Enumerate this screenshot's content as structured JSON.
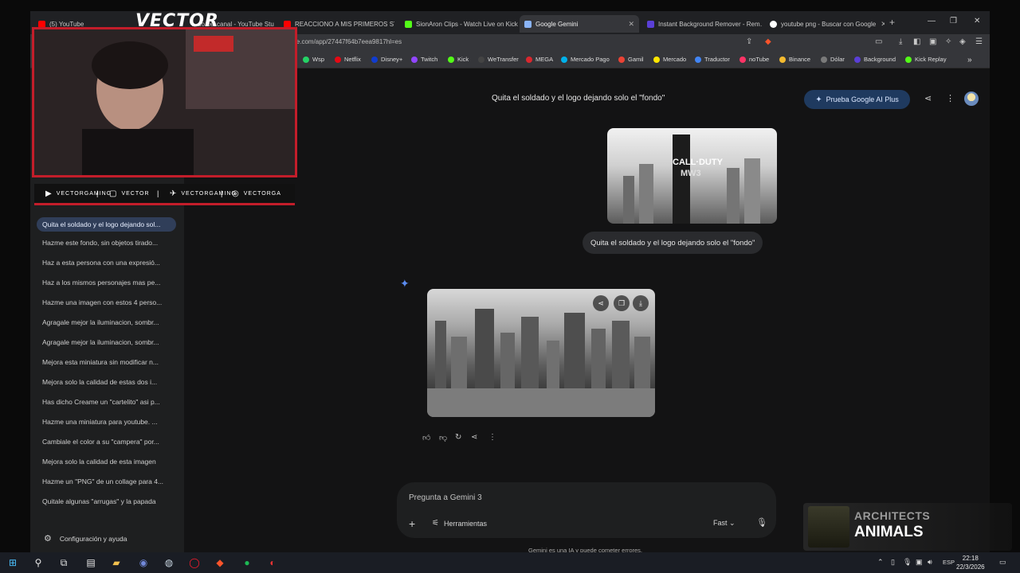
{
  "browser": {
    "tabs": [
      {
        "label": "(5) YouTube",
        "color": "#ff0000"
      },
      {
        "label": "…do del canal - YouTube Studio",
        "color": "#ff0000"
      },
      {
        "label": "REACCIONO A MIS PRIMEROS STRE…",
        "color": "#ff0000"
      },
      {
        "label": "SionAron Clips - Watch Live on Kick",
        "color": "#53fc18"
      },
      {
        "label": "Google Gemini",
        "color": "#8ab4f8"
      },
      {
        "label": "Instant Background Remover - Rem…",
        "color": "#5a3fd6"
      },
      {
        "label": "youtube png - Buscar con Google",
        "color": "#ffffff"
      }
    ],
    "url": "le.com/app/27447f64b7eea9817hl=es",
    "bookmarks": [
      "Wsp",
      "Netflix",
      "Disney+",
      "Twitch",
      "Kick",
      "WeTransfer",
      "MEGA",
      "Mercado Pago",
      "Gamil",
      "Mercado",
      "Traductor",
      "noTube",
      "Binance",
      "Dólar",
      "Background",
      "Kick Replay"
    ]
  },
  "gemini": {
    "chat_title": "Quita el soldado y el logo dejando solo el \"fondo\"",
    "upgrade_label": "Prueba Google AI Plus",
    "sidebar_items": [
      "Quita el soldado y el logo dejando sol...",
      "Hazme este fondo, sin objetos tirado...",
      "Haz a esta persona con una expresió...",
      "Haz a los mismos personajes mas pe...",
      "Hazme una imagen con estos 4 perso...",
      "Agragale mejor la iluminacion, sombr...",
      "Agragale mejor la iluminacion, sombr...",
      "Mejora esta miniatura sin modificar n...",
      "Mejora solo la calidad de estas dos i...",
      "Has dicho Creame un \"cartelito\" asi p...",
      "Hazme una miniatura para youtube. ...",
      "Cambiale el color a su \"campera\" por...",
      "Mejora solo la calidad de esta imagen",
      "Hazme un \"PNG\" de un collage para 4...",
      "Quitale algunas \"arrugas\" y la papada"
    ],
    "settings_label": "Configuración y ayuda",
    "user_image_text": [
      "CALL·DUTY",
      "MW3"
    ],
    "user_message": "Quita el soldado y el logo dejando solo el \"fondo\"",
    "input_placeholder": "Pregunta a Gemini 3",
    "tools_label": "Herramientas",
    "mode_label": "Fast",
    "disclaimer": "Gemini es una IA y puede cometer errores."
  },
  "overlay": {
    "logo": "VECTOR",
    "socials": [
      {
        "icon": "youtube-icon",
        "label": "VECTORGAMING"
      },
      {
        "icon": "chat-icon",
        "label": "VECTOR"
      },
      {
        "icon": "twitter-icon",
        "label": "VECTORGAMING"
      },
      {
        "icon": "instagram-icon",
        "label": "VECTORGA"
      }
    ],
    "now_playing": {
      "artist": "ARCHITECTS",
      "title": "ANIMALS"
    }
  },
  "taskbar": {
    "lang": "ESP",
    "time": "22:18",
    "date": "22/3/2026"
  },
  "colors": {
    "accent_blue": "#1f3a5f",
    "brand_red": "#c31d2a",
    "gemini_spark": "#5b8cf0"
  }
}
